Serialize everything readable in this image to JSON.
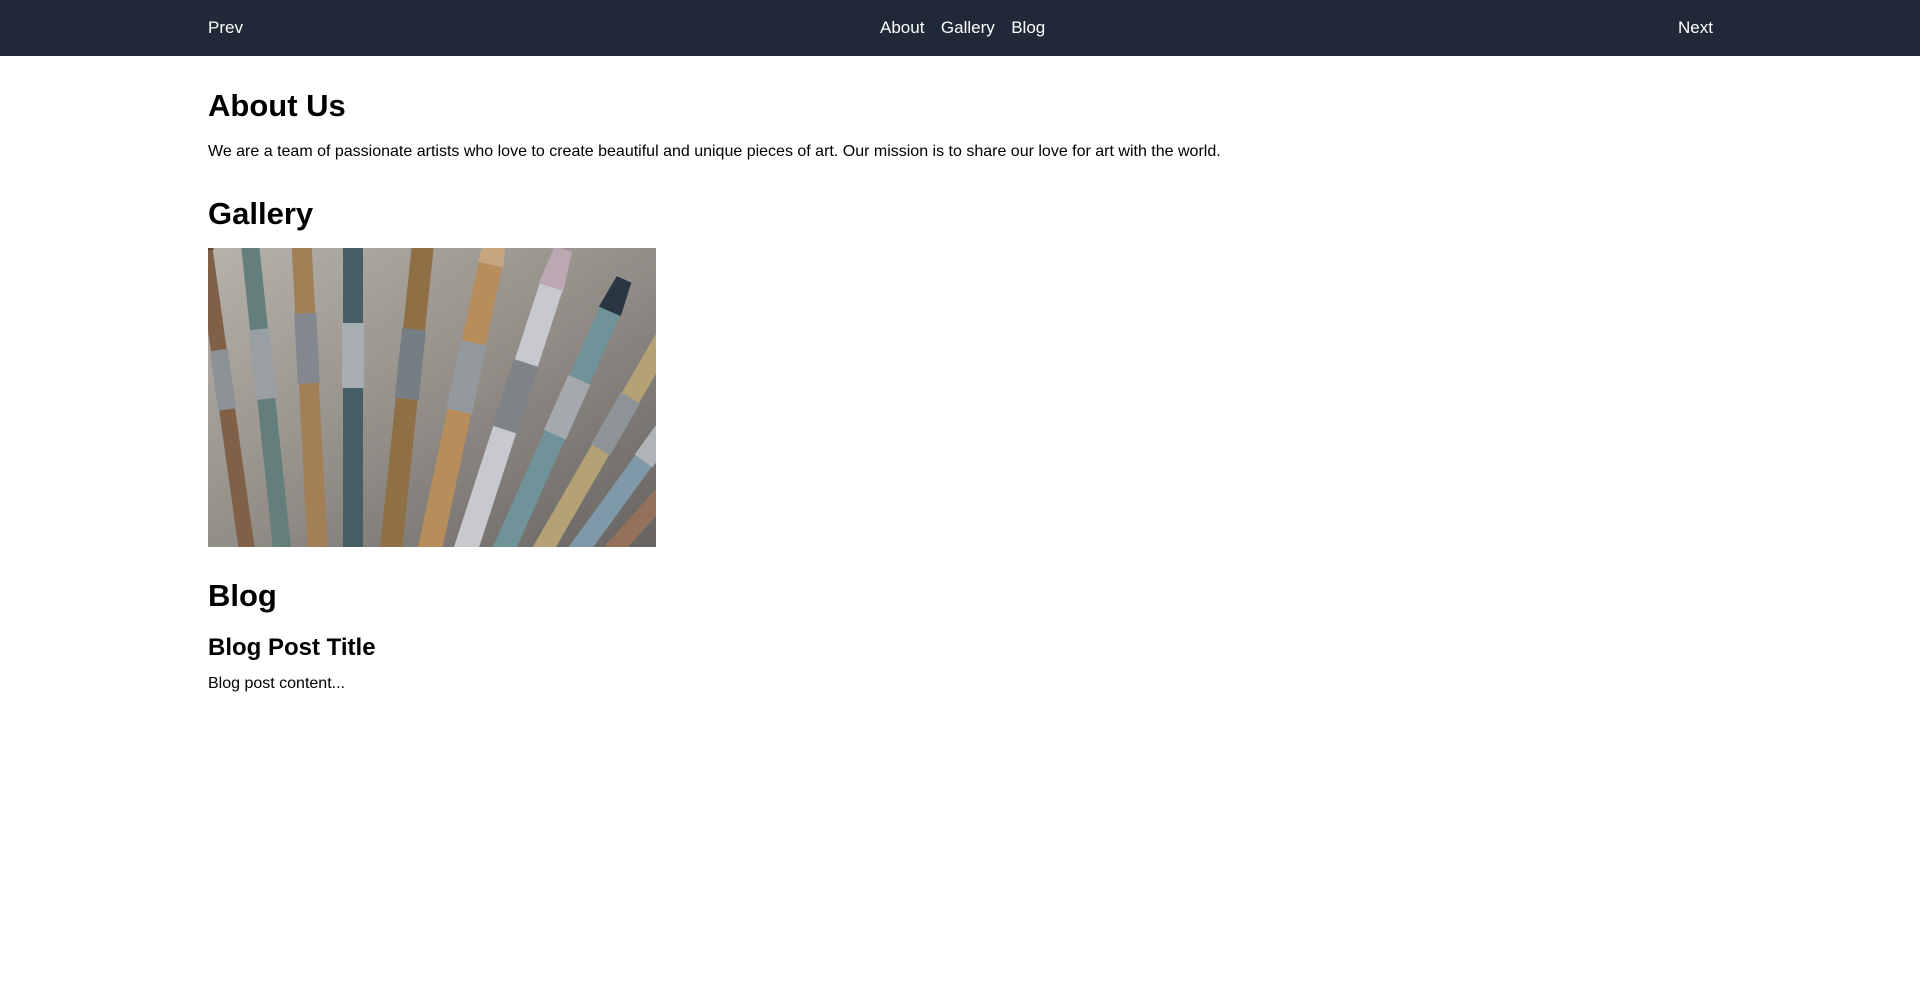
{
  "nav": {
    "prev_label": "Prev",
    "next_label": "Next",
    "links": [
      "About",
      "Gallery",
      "Blog"
    ]
  },
  "about": {
    "heading": "About Us",
    "text": "We are a team of passionate artists who love to create beautiful and unique pieces of art. Our mission is to share our love for art with the world."
  },
  "gallery": {
    "heading": "Gallery",
    "image_name": "paintbrushes-image"
  },
  "blog": {
    "heading": "Blog",
    "post_title": "Blog Post Title",
    "post_content": "Blog post content..."
  },
  "colors": {
    "nav_bg": "#1f2937",
    "nav_text": "#ffffff"
  }
}
